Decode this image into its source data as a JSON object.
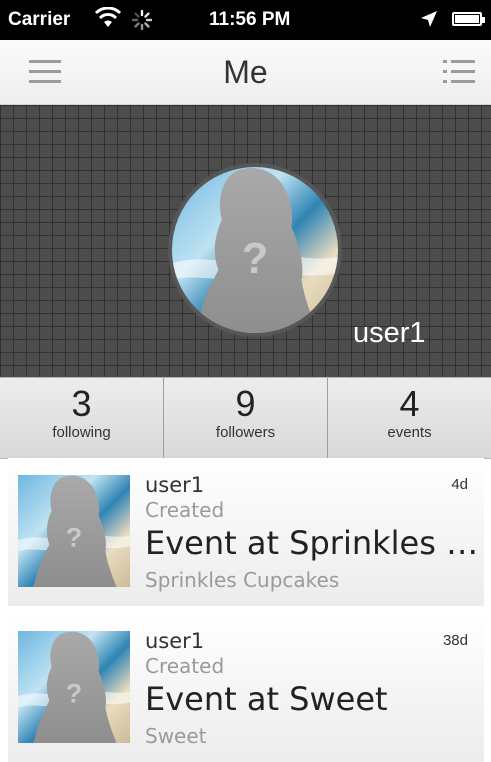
{
  "status_bar": {
    "carrier": "Carrier",
    "time": "11:56 PM"
  },
  "nav": {
    "title": "Me",
    "menu_icon": "hamburger-icon",
    "list_icon": "list-icon"
  },
  "profile": {
    "username": "user1",
    "avatar_icon": "placeholder-avatar-icon",
    "avatar_glyph": "?"
  },
  "stats": [
    {
      "count": "3",
      "label": "following"
    },
    {
      "count": "9",
      "label": "followers"
    },
    {
      "count": "4",
      "label": "events"
    }
  ],
  "feed": [
    {
      "user": "user1",
      "action": "Created",
      "title": "Event at Sprinkles Cupcakes",
      "venue": "Sprinkles Cupcakes",
      "time": "4d",
      "glyph": "?"
    },
    {
      "user": "user1",
      "action": "Created",
      "title": "Event at Sweet",
      "venue": "Sweet",
      "time": "38d",
      "glyph": "?"
    }
  ],
  "colors": {
    "banner": "#4c4c4c",
    "navbar": "#f5f5f5",
    "ocean": "#3b8fb8"
  }
}
